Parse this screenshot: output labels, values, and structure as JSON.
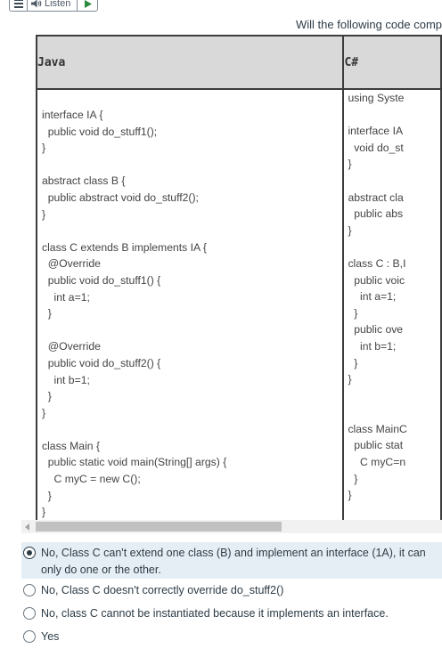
{
  "toolbar": {
    "listen_label": "Listen"
  },
  "question": {
    "text": "Will the following code comp"
  },
  "table": {
    "headers": {
      "java": "Java",
      "csharp": "C#"
    },
    "java_code": "interface IA {\n  public void do_stuff1();\n}\n\nabstract class B {\n  public abstract void do_stuff2();\n}\n\nclass C extends B implements IA {\n  @Override\n  public void do_stuff1() {\n    int a=1;\n  }\n\n  @Override\n  public void do_stuff2() {\n    int b=1;\n  }\n}\n\nclass Main {\n  public static void main(String[] args) {\n    C myC = new C();\n  }\n}",
    "csharp_code": "using Syste\n\ninterface IA\n  void do_st\n}\n\nabstract cla\n  public abs\n}\n\nclass C : B,I\n  public voic\n    int a=1;\n  }\n  public ove\n    int b=1;\n  }\n}\n\n\nclass MainC\n  public stat\n    C myC=n\n  }\n}"
  },
  "answers": [
    {
      "text": "No, Class C can't extend one class (B) and implement an interface (1A), it can only do one or the other.",
      "selected": true
    },
    {
      "text": "No, Class C doesn't correctly override do_stuff2()",
      "selected": false
    },
    {
      "text": "No, class C cannot be instantiated because it implements an interface.",
      "selected": false
    },
    {
      "text": "Yes",
      "selected": false
    }
  ],
  "colors": {
    "selected_bg": "#e6eef5",
    "header_bg": "#d9d9d9",
    "play_green": "#2b8a3e"
  }
}
